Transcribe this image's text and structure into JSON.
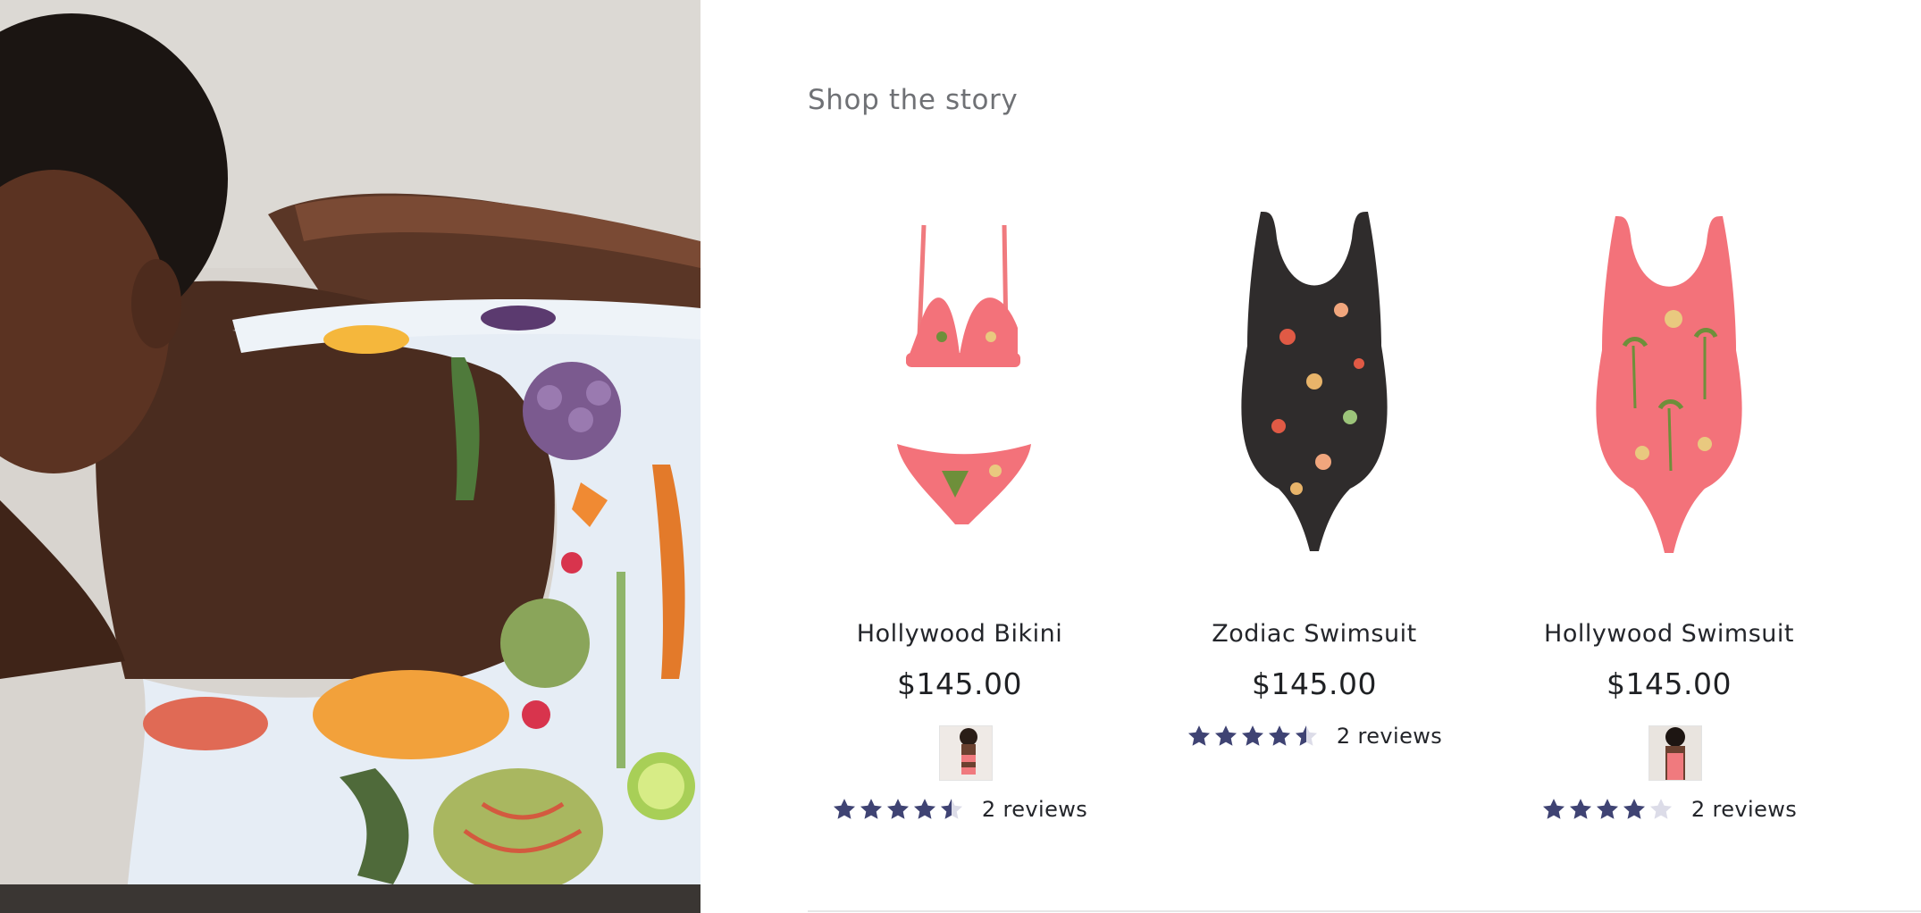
{
  "section": {
    "title": "Shop the story"
  },
  "products": [
    {
      "title": "Hollywood Bikini",
      "price": "$145.00",
      "rating": 4.5,
      "reviews_label": "2 reviews",
      "has_swatch": true,
      "image": "pink-palm-print-bikini"
    },
    {
      "title": "Zodiac Swimsuit",
      "price": "$145.00",
      "rating": 4.5,
      "reviews_label": "2 reviews",
      "has_swatch": false,
      "image": "black-zodiac-one-piece"
    },
    {
      "title": "Hollywood Swimsuit",
      "price": "$145.00",
      "rating": 4,
      "reviews_label": "2 reviews",
      "has_swatch": true,
      "image": "pink-palm-print-one-piece"
    }
  ],
  "colors": {
    "star": "#3f4373",
    "star_empty": "#dcdce8",
    "bikini_pink": "#f3727a",
    "zodiac_black": "#2f2c2c",
    "title_gray": "#6f7175"
  }
}
